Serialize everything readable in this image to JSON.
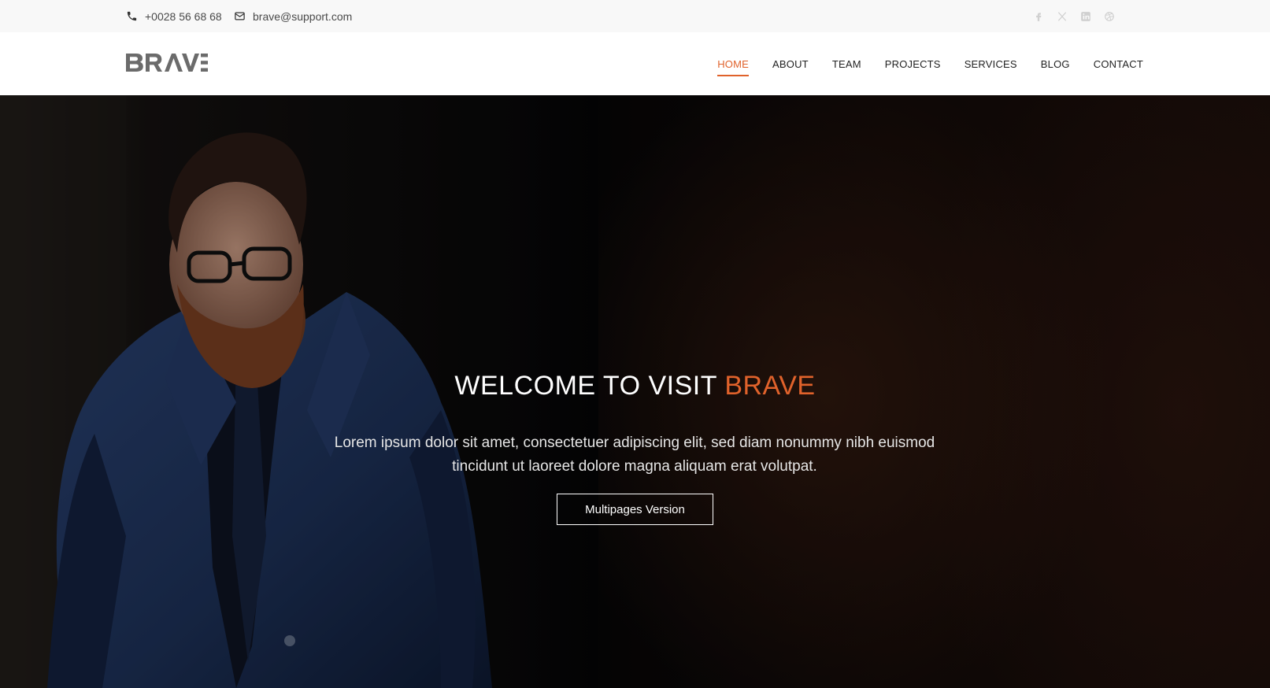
{
  "topbar": {
    "phone": "+0028 56 68 68",
    "email": "brave@support.com",
    "social": [
      "facebook-icon",
      "x-icon",
      "linkedin-icon",
      "dribbble-icon"
    ]
  },
  "header": {
    "logo_text": "BRAVE",
    "nav": [
      {
        "label": "HOME",
        "active": true
      },
      {
        "label": "ABOUT"
      },
      {
        "label": "TEAM"
      },
      {
        "label": "PROJECTS"
      },
      {
        "label": "SERVICES"
      },
      {
        "label": "BLOG"
      },
      {
        "label": "CONTACT"
      }
    ]
  },
  "hero": {
    "title_prefix": "WELCOME TO VISIT",
    "title_accent": "BRAVE",
    "text": "Lorem ipsum dolor sit amet, consectetuer adipiscing elit, sed diam nonummy nibh euismod tincidunt ut laoreet dolore magna aliquam erat volutpat.",
    "button_label": "Multipages Version"
  },
  "colors": {
    "accent": "#e0622b",
    "topbar_bg": "#f8f8f8",
    "text_dark": "#222222"
  }
}
